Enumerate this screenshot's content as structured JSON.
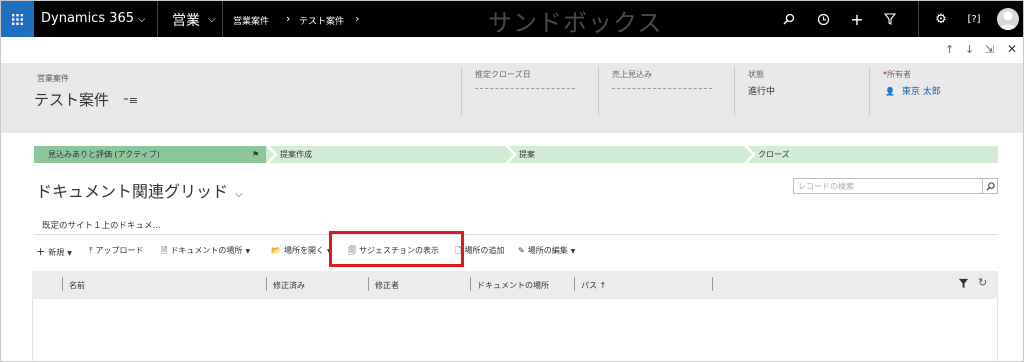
{
  "nav": {
    "app_name": "Dynamics 365",
    "area": "営業",
    "breadcrumb": [
      "営業案件",
      "テスト案件"
    ],
    "environment_banner": "サンドボックス",
    "icons": [
      "waffle-icon",
      "search-icon",
      "recent-icon",
      "plus-icon",
      "filter-icon",
      "settings-icon",
      "help-icon",
      "user-avatar"
    ]
  },
  "subbar": {
    "icons": [
      "arrow-up-icon",
      "arrow-down-icon",
      "popout-icon",
      "close-icon"
    ]
  },
  "header": {
    "entity_type": "営業案件",
    "record_name": "テスト案件",
    "fields": [
      {
        "label": "推定クローズ日",
        "value": ""
      },
      {
        "label": "売上見込み",
        "value": ""
      },
      {
        "label": "状態",
        "value": "進行中"
      },
      {
        "label": "所有者",
        "value": "東京 太郎",
        "required": true
      }
    ]
  },
  "process": {
    "stages": [
      {
        "label": "見込みありと評価 (アクティブ)",
        "active": true
      },
      {
        "label": "提案作成",
        "active": false
      },
      {
        "label": "提案",
        "active": false
      },
      {
        "label": "クローズ",
        "active": false
      }
    ]
  },
  "grid": {
    "title": "ドキュメント関連グリッド",
    "search_placeholder": "レコードの検索",
    "site_tab": "既定のサイト１上のドキュメ...",
    "commands": [
      {
        "label": "新規",
        "icon": "plus-icon",
        "dropdown": true
      },
      {
        "label": "アップロード",
        "icon": "upload-icon",
        "dropdown": false
      },
      {
        "label": "ドキュメントの場所",
        "icon": "document-location-icon",
        "dropdown": true
      },
      {
        "label": "場所を開く",
        "icon": "folder-open-icon",
        "dropdown": true
      },
      {
        "label": "サジェスチョンの表示",
        "icon": "suggestion-icon",
        "dropdown": false
      },
      {
        "label": "場所の追加",
        "icon": "add-location-icon",
        "dropdown": false
      },
      {
        "label": "場所の編集",
        "icon": "edit-location-icon",
        "dropdown": true
      }
    ],
    "columns": [
      "名前",
      "修正済み",
      "修正者",
      "ドキュメントの場所",
      "パス ↑"
    ]
  },
  "colors": {
    "nav_bg": "#000000",
    "waffle_bg": "#1e6fbf",
    "header_bg": "#e9e9e9",
    "active_stage": "#8cc69c",
    "inactive_stage": "#d3ecd6",
    "highlight_border": "#e0191f",
    "link": "#1160b7"
  }
}
